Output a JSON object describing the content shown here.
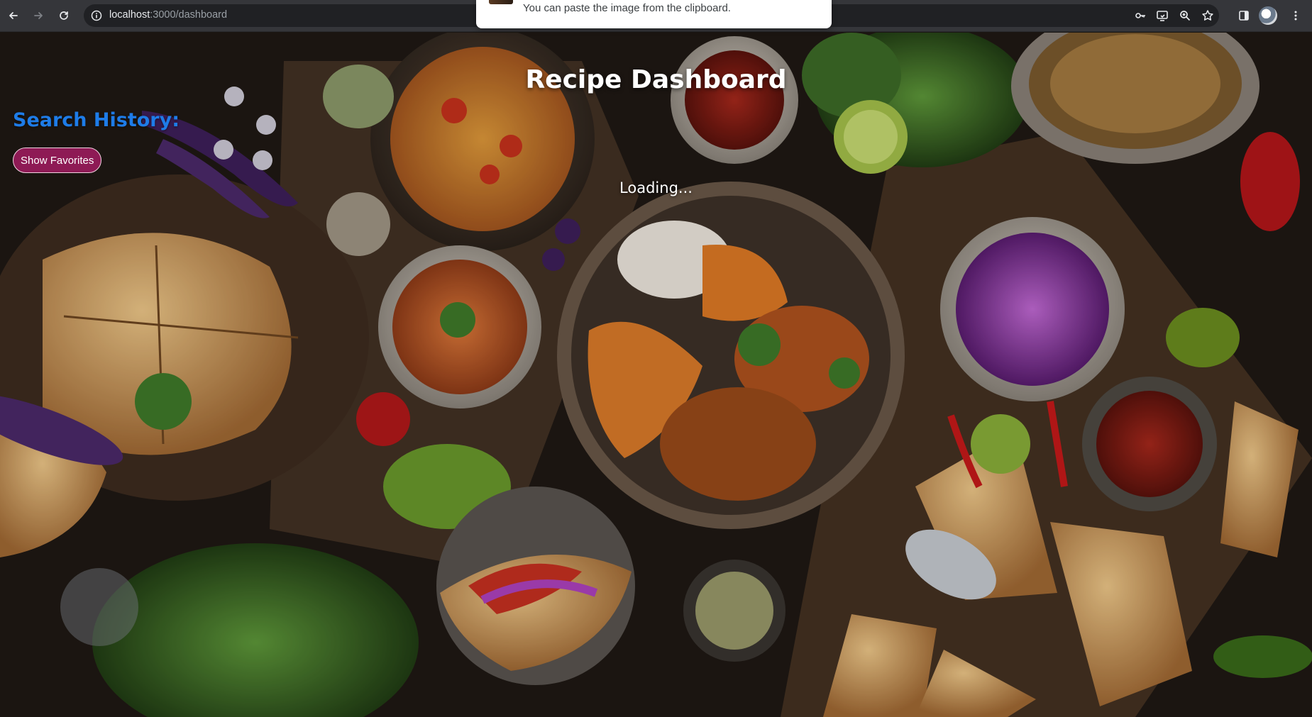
{
  "browser": {
    "url_host": "localhost",
    "url_path": ":3000/dashboard",
    "icons": {
      "back": "arrow-left-icon",
      "forward": "arrow-right-icon",
      "reload": "reload-icon",
      "site_info": "info-icon",
      "password": "key-icon",
      "cast": "cast-icon",
      "zoom": "zoom-icon",
      "bookmark": "star-icon",
      "side_panel": "side-panel-icon",
      "menu": "kebab-menu-icon"
    }
  },
  "toast": {
    "message": "You can paste the image from the clipboard."
  },
  "page": {
    "title": "Recipe Dashboard",
    "search_history_heading": "Search History:",
    "show_favorites_label": "Show Favorites",
    "loading_text": "Loading...",
    "colors": {
      "heading_blue": "#1e7ce8",
      "button_bg": "#8e1a55",
      "text_white": "#ffffff"
    }
  }
}
